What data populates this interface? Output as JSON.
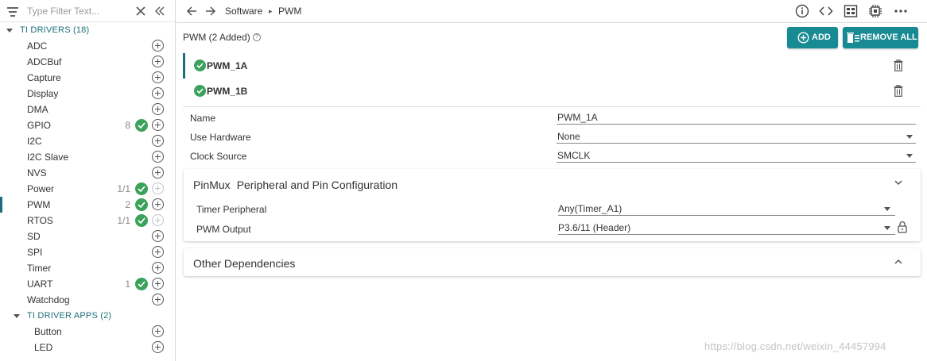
{
  "sidebar": {
    "filter_placeholder": "Type Filter Text...",
    "groups": [
      {
        "label": "TI DRIVERS (18)"
      },
      {
        "label": "TI DRIVER APPS (2)"
      }
    ],
    "items": [
      {
        "label": "ADC",
        "count": "",
        "checked": false
      },
      {
        "label": "ADCBuf",
        "count": "",
        "checked": false
      },
      {
        "label": "Capture",
        "count": "",
        "checked": false
      },
      {
        "label": "Display",
        "count": "",
        "checked": false
      },
      {
        "label": "DMA",
        "count": "",
        "checked": false
      },
      {
        "label": "GPIO",
        "count": "8",
        "checked": true
      },
      {
        "label": "I2C",
        "count": "",
        "checked": false
      },
      {
        "label": "I2C Slave",
        "count": "",
        "checked": false
      },
      {
        "label": "NVS",
        "count": "",
        "checked": false
      },
      {
        "label": "Power",
        "count": "1/1",
        "checked": true
      },
      {
        "label": "PWM",
        "count": "2",
        "checked": true
      },
      {
        "label": "RTOS",
        "count": "1/1",
        "checked": true
      },
      {
        "label": "SD",
        "count": "",
        "checked": false
      },
      {
        "label": "SPI",
        "count": "",
        "checked": false
      },
      {
        "label": "Timer",
        "count": "",
        "checked": false
      },
      {
        "label": "UART",
        "count": "1",
        "checked": true
      },
      {
        "label": "Watchdog",
        "count": "",
        "checked": false
      },
      {
        "label": "Button",
        "count": "",
        "checked": false
      },
      {
        "label": "LED",
        "count": "",
        "checked": false
      }
    ]
  },
  "breadcrumb": {
    "parent": "Software",
    "separator": "▸",
    "current": "PWM"
  },
  "main": {
    "title": "PWM (2 Added)",
    "add_label": "ADD",
    "remove_all_label": "REMOVE ALL",
    "instances": [
      "PWM_1A",
      "PWM_1B"
    ],
    "properties": {
      "name_label": "Name",
      "name_value": "PWM_1A",
      "hardware_label": "Use Hardware",
      "hardware_value": "None",
      "clock_label": "Clock Source",
      "clock_value": "SMCLK"
    },
    "pinmux": {
      "title": "PinMux",
      "subtitle": "Peripheral and Pin Configuration",
      "timer_label": "Timer Peripheral",
      "timer_value": "Any(Timer_A1)",
      "output_label": "PWM Output",
      "output_value": "P3.6/11 (Header)"
    },
    "other_deps_title": "Other Dependencies"
  },
  "watermark": "https://blog.csdn.net/weixin_44457994",
  "colors": {
    "accent": "#188a93",
    "check": "#3aa25a",
    "group_label": "#1a6f7a"
  }
}
